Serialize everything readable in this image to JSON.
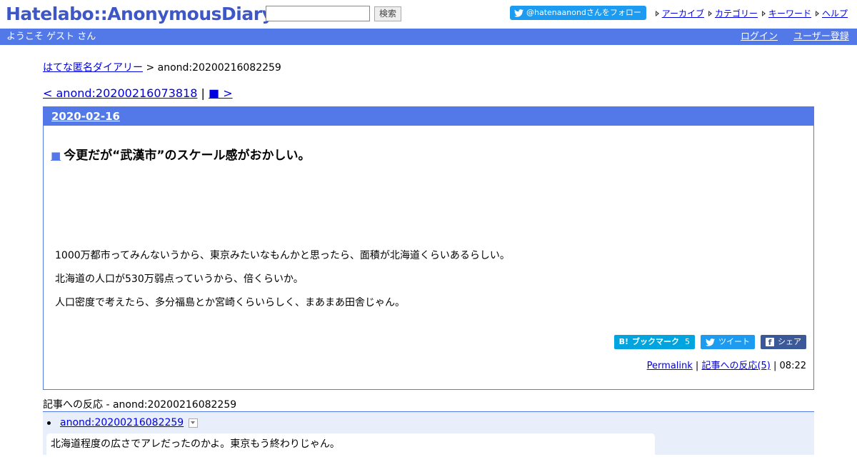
{
  "header": {
    "logo": "Hatelabo::AnonymousDiary",
    "search": {
      "value": "",
      "placeholder": "",
      "button_label": "検索"
    },
    "follow_label": "@hatenaanondさんをフォロー",
    "links": [
      {
        "label": "アーカイブ"
      },
      {
        "label": "カテゴリー"
      },
      {
        "label": "キーワード"
      },
      {
        "label": "ヘルプ"
      }
    ]
  },
  "userbar": {
    "welcome": "ようこそ ゲスト さん",
    "login": "ログイン",
    "signup": "ユーザー登録"
  },
  "breadcrumb": {
    "home": "はてな匿名ダイアリー",
    "separator": " > ",
    "current": "anond:20200216082259"
  },
  "pager": {
    "prev": "< anond:20200216073818",
    "separator": " | ",
    "next": "■ >"
  },
  "entry": {
    "date": "2020-02-16",
    "title_mark": "■",
    "title": "今更だが“武漢市”のスケール感がおかしい。",
    "paragraphs": [
      "1000万都市ってみんないうから、東京みたいなもんかと思ったら、面積が北海道くらいあるらしい。",
      "北海道の人口が530万弱点っていうから、倍くらいか。",
      "人口密度で考えたら、多分福島とか宮崎くらいらしく、まあまあ田舎じゃん。"
    ],
    "share": {
      "bookmark_label": "ブックマーク",
      "bookmark_count": "5",
      "tweet_label": "ツイート",
      "fb_label": "シェア"
    },
    "footer": {
      "permalink": "Permalink",
      "sep1": " | ",
      "reactions_link": "記事への反応(5)",
      "sep2": " | ",
      "time": "08:22"
    }
  },
  "reactions": {
    "heading": "記事への反応 - anond:20200216082259",
    "items": [
      {
        "id": "anond:20200216082259",
        "text": "北海道程度の広さでアレだったのかよ。東京もう終わりじゃん。"
      }
    ]
  },
  "colors": {
    "accent": "#5279e7",
    "logo": "#3e57c8",
    "twitter": "#1d9bf0",
    "hatena": "#00a4de",
    "facebook": "#3b5998"
  }
}
